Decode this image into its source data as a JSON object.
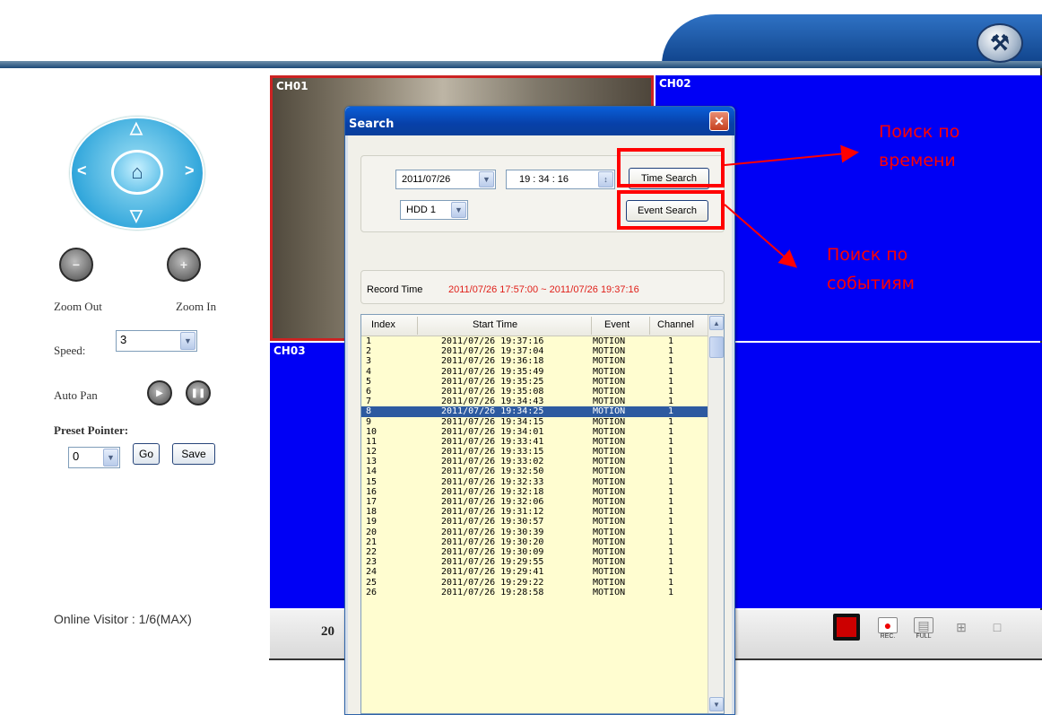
{
  "header": {
    "tool_icon": "wrench-icon"
  },
  "channels": {
    "ch1": "CH01",
    "ch2": "CH02",
    "ch3": "CH03"
  },
  "ptz": {
    "zoom_out_label": "Zoom Out",
    "zoom_in_label": "Zoom In",
    "speed_label": "Speed:",
    "speed_value": "3",
    "auto_pan_label": "Auto Pan",
    "preset_label": "Preset Pointer:",
    "preset_value": "0",
    "go_label": "Go",
    "save_label": "Save"
  },
  "status": {
    "online_visitor": "Online Visitor : 1/6(MAX)",
    "bottom_date": "20"
  },
  "toolbar": {
    "rec_label": "REC.",
    "full_label": "FULL"
  },
  "search_dialog": {
    "title": "Search",
    "date_value": "2011/07/26",
    "time_value": "19 : 34 : 16",
    "hdd_value": "HDD 1",
    "time_search_label": "Time Search",
    "event_search_label": "Event Search",
    "record_time_label": "Record Time",
    "record_time_range": "2011/07/26 17:57:00 ~ 2011/07/26 19:37:16",
    "columns": [
      "Index",
      "Start Time",
      "Event",
      "Channel"
    ],
    "selected_index": 8,
    "rows": [
      [
        "1",
        "2011/07/26 19:37:16",
        "MOTION",
        "1"
      ],
      [
        "2",
        "2011/07/26 19:37:04",
        "MOTION",
        "1"
      ],
      [
        "3",
        "2011/07/26 19:36:18",
        "MOTION",
        "1"
      ],
      [
        "4",
        "2011/07/26 19:35:49",
        "MOTION",
        "1"
      ],
      [
        "5",
        "2011/07/26 19:35:25",
        "MOTION",
        "1"
      ],
      [
        "6",
        "2011/07/26 19:35:08",
        "MOTION",
        "1"
      ],
      [
        "7",
        "2011/07/26 19:34:43",
        "MOTION",
        "1"
      ],
      [
        "8",
        "2011/07/26 19:34:25",
        "MOTION",
        "1"
      ],
      [
        "9",
        "2011/07/26 19:34:15",
        "MOTION",
        "1"
      ],
      [
        "10",
        "2011/07/26 19:34:01",
        "MOTION",
        "1"
      ],
      [
        "11",
        "2011/07/26 19:33:41",
        "MOTION",
        "1"
      ],
      [
        "12",
        "2011/07/26 19:33:15",
        "MOTION",
        "1"
      ],
      [
        "13",
        "2011/07/26 19:33:02",
        "MOTION",
        "1"
      ],
      [
        "14",
        "2011/07/26 19:32:50",
        "MOTION",
        "1"
      ],
      [
        "15",
        "2011/07/26 19:32:33",
        "MOTION",
        "1"
      ],
      [
        "16",
        "2011/07/26 19:32:18",
        "MOTION",
        "1"
      ],
      [
        "17",
        "2011/07/26 19:32:06",
        "MOTION",
        "1"
      ],
      [
        "18",
        "2011/07/26 19:31:12",
        "MOTION",
        "1"
      ],
      [
        "19",
        "2011/07/26 19:30:57",
        "MOTION",
        "1"
      ],
      [
        "20",
        "2011/07/26 19:30:39",
        "MOTION",
        "1"
      ],
      [
        "21",
        "2011/07/26 19:30:20",
        "MOTION",
        "1"
      ],
      [
        "22",
        "2011/07/26 19:30:09",
        "MOTION",
        "1"
      ],
      [
        "23",
        "2011/07/26 19:29:55",
        "MOTION",
        "1"
      ],
      [
        "24",
        "2011/07/26 19:29:41",
        "MOTION",
        "1"
      ],
      [
        "25",
        "2011/07/26 19:29:22",
        "MOTION",
        "1"
      ],
      [
        "26",
        "2011/07/26 19:28:58",
        "MOTION",
        "1"
      ]
    ]
  },
  "annotations": {
    "time_note_1": "Поиск по",
    "time_note_2": "времени",
    "event_note_1": "Поиск по",
    "event_note_2": "событиям",
    "color": "#ff0000"
  }
}
